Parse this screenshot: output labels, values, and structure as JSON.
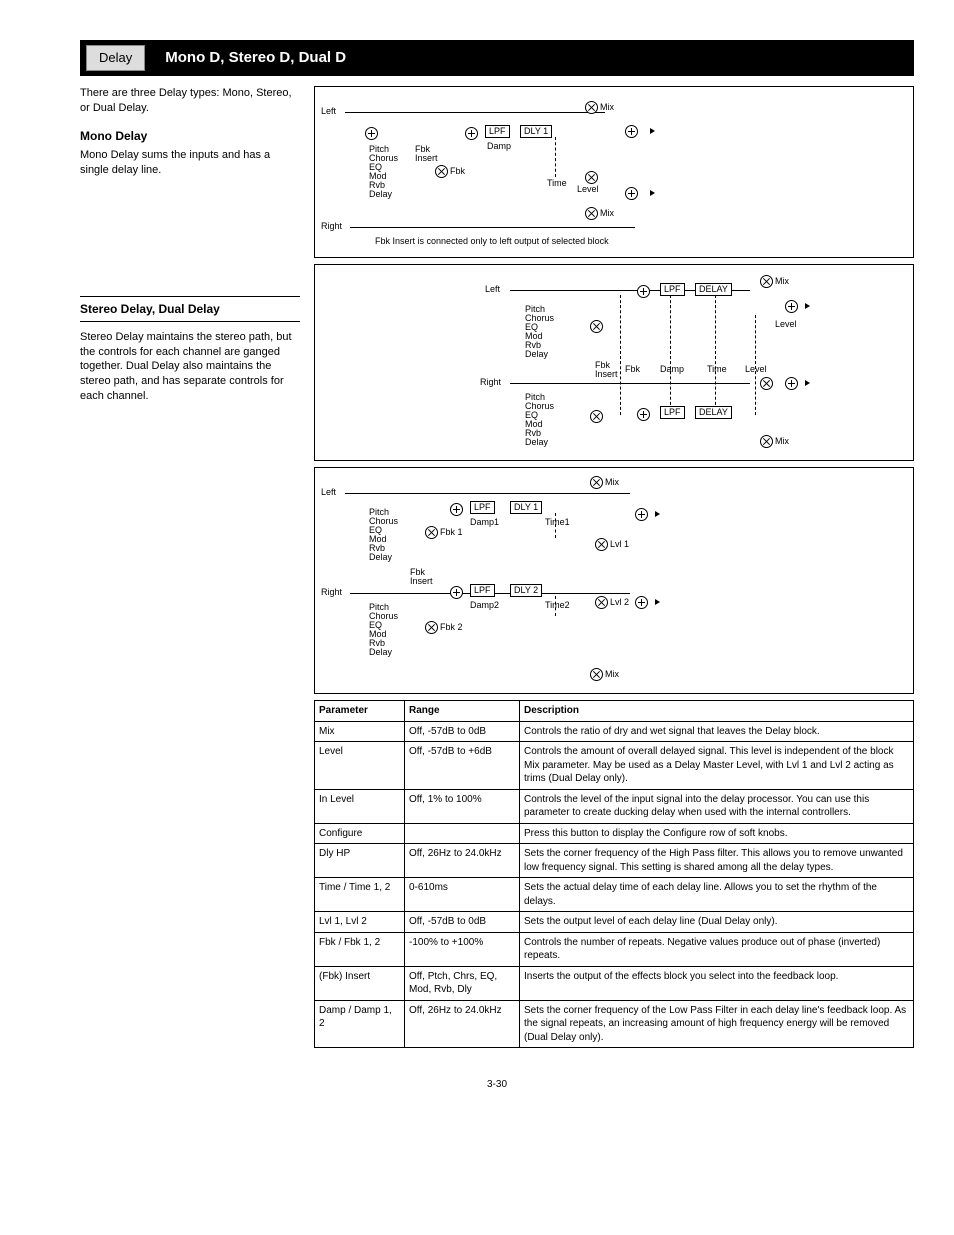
{
  "header": {
    "tab": "Delay",
    "title": "Mono D, Stereo D, Dual D"
  },
  "left": {
    "intro": "There are three Delay types: Mono, Stereo, or Dual Delay.",
    "sec1_title": "Mono Delay",
    "sec1_body": "Mono Delay sums the inputs and has a single delay line.",
    "rule_title": "Stereo Delay, Dual Delay",
    "sec2_body": "Stereo Delay maintains the stereo path, but the controls for each channel are ganged together. Dual Delay also maintains the stereo path, and has separate controls for each channel."
  },
  "diagram": {
    "labels_left": [
      "Pitch",
      "Chorus",
      "EQ",
      "Mod",
      "Rvb",
      "Delay"
    ],
    "labels": {
      "left": "Left",
      "right": "Right",
      "lpf": "LPF",
      "dly1": "DLY 1",
      "dly2": "DLY 2",
      "delay": "DELAY",
      "fbkins": "Fbk\nInsert",
      "fbk": "Fbk",
      "damp": "Damp",
      "damp1": "Damp1",
      "damp2": "Damp2",
      "time": "Time",
      "time1": "Time1",
      "time2": "Time2",
      "mix": "Mix",
      "level": "Level",
      "lvl1": "Lvl 1",
      "lvl2": "Lvl 2",
      "fbk1": "Fbk 1",
      "fbk2": "Fbk 2",
      "caption1": "Fbk Insert is connected only to left output of selected block"
    }
  },
  "table": {
    "headers": [
      "Parameter",
      "Range",
      "Description"
    ],
    "rows": [
      [
        "Mix",
        "Off, -57dB to 0dB",
        "Controls the ratio of dry and wet signal that leaves the Delay block."
      ],
      [
        "Level",
        "Off, -57dB to +6dB",
        "Controls the amount of overall delayed signal. This level is independent of the block Mix parameter. May be used as a Delay Master Level, with Lvl 1 and Lvl 2 acting as trims (Dual Delay only)."
      ],
      [
        "In Level",
        "Off, 1% to 100%",
        "Controls the level of the input signal into the delay processor. You can use this parameter to create ducking delay when used with the internal controllers."
      ],
      [
        "Configure",
        "",
        "Press this button to display the Configure row of soft knobs."
      ],
      [
        "Dly HP",
        "Off, 26Hz to 24.0kHz",
        "Sets the corner frequency of the High Pass filter. This allows you to remove unwanted low frequency signal. This setting is shared among all the delay types."
      ],
      [
        "Time / Time 1, 2",
        "0-610ms",
        "Sets the actual delay time of each delay line. Allows you to set the rhythm of the delays."
      ],
      [
        "Lvl 1, Lvl 2",
        "Off, -57dB to 0dB",
        "Sets the output level of each delay line (Dual Delay only)."
      ],
      [
        "Fbk / Fbk 1, 2",
        "-100% to +100%",
        "Controls the number of repeats. Negative values produce out of phase (inverted) repeats."
      ],
      [
        "(Fbk) Insert",
        "Off, Ptch, Chrs, EQ, Mod, Rvb, Dly",
        "Inserts the output of the effects block you select into the feedback loop."
      ],
      [
        "Damp / Damp 1, 2",
        "Off, 26Hz to 24.0kHz",
        "Sets the corner frequency of the Low Pass Filter in each delay line's feedback loop. As the signal repeats, an increasing amount of high frequency energy will be removed (Dual Delay only)."
      ]
    ]
  },
  "footer": "3-30"
}
